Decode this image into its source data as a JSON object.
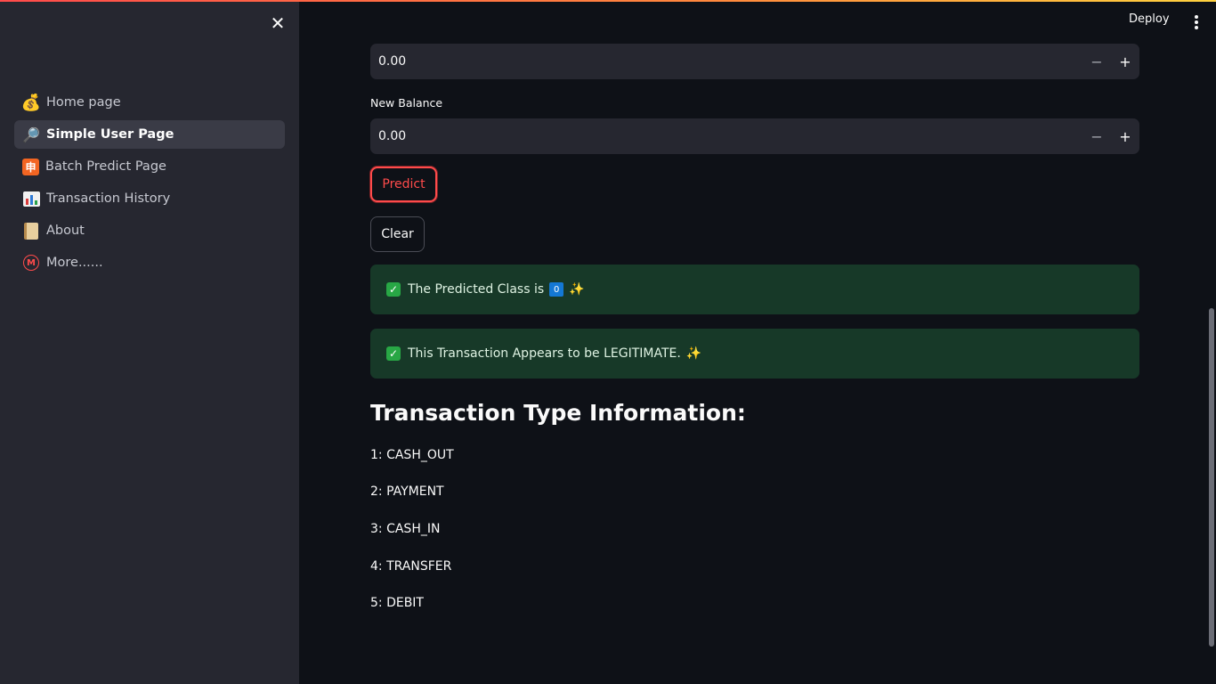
{
  "sidebar": {
    "items": [
      {
        "label": "Home page",
        "icon": "money-bag-icon",
        "active": false
      },
      {
        "label": "Simple User Page",
        "icon": "magnifier-icon",
        "active": true
      },
      {
        "label": "Batch Predict Page",
        "icon": "batch-icon",
        "active": false
      },
      {
        "label": "Transaction History",
        "icon": "bar-chart-icon",
        "active": false
      },
      {
        "label": "About",
        "icon": "scroll-icon",
        "active": false
      },
      {
        "label": "More......",
        "icon": "m-circle-icon",
        "active": false
      }
    ]
  },
  "header": {
    "deploy_label": "Deploy"
  },
  "form": {
    "prev_balance_value": "0.00",
    "new_balance_label": "New Balance",
    "new_balance_value": "0.00",
    "predict_label": "Predict",
    "clear_label": "Clear"
  },
  "results": {
    "predicted_prefix": "The Predicted Class is",
    "predicted_class": "0",
    "verdict_text": "This Transaction Appears to be LEGITIMATE."
  },
  "info": {
    "heading": "Transaction Type Information:",
    "types": [
      "1: CASH_OUT",
      "2: PAYMENT",
      "3: CASH_IN",
      "4: TRANSFER",
      "5: DEBIT"
    ]
  },
  "colors": {
    "accent": "#ff4b4b",
    "background": "#0e1117",
    "sidebar": "#262730",
    "success_bg": "#173928"
  }
}
